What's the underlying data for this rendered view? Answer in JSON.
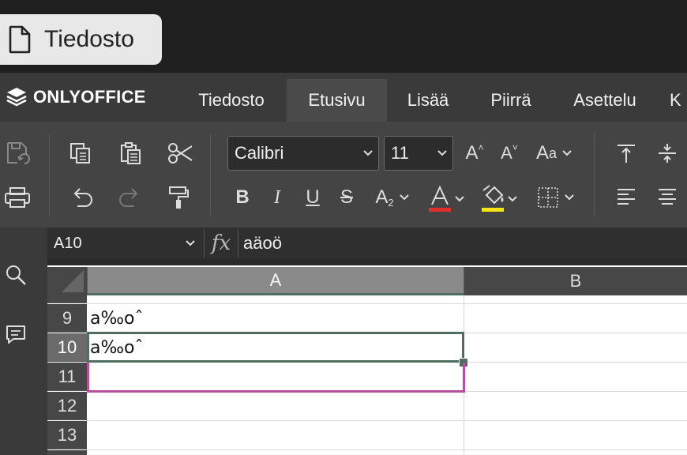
{
  "window": {
    "file_tab_label": "Tiedosto"
  },
  "brand": {
    "name": "ONLYOFFICE"
  },
  "menu": {
    "tabs": [
      {
        "label": "Tiedosto"
      },
      {
        "label": "Etusivu"
      },
      {
        "label": "Lisää"
      },
      {
        "label": "Piirrä"
      },
      {
        "label": "Asettelu"
      },
      {
        "label": "K"
      }
    ],
    "active_tab": "Etusivu"
  },
  "toolbar": {
    "font_name": "Calibri",
    "font_size": "11",
    "font_color": "#e0302b",
    "highlight_color": "#f3e50f"
  },
  "formula_bar": {
    "name_box": "A10",
    "fx_label": "fx",
    "value": "aäoö"
  },
  "grid": {
    "columns": [
      "A",
      "B"
    ],
    "rows": [
      {
        "num": "9",
        "a": "a‰oˆ",
        "b": ""
      },
      {
        "num": "10",
        "a": "a‰oˆ",
        "b": ""
      },
      {
        "num": "11",
        "a": "",
        "b": ""
      },
      {
        "num": "12",
        "a": "",
        "b": ""
      },
      {
        "num": "13",
        "a": "",
        "b": ""
      }
    ],
    "active_cell": "A10"
  }
}
